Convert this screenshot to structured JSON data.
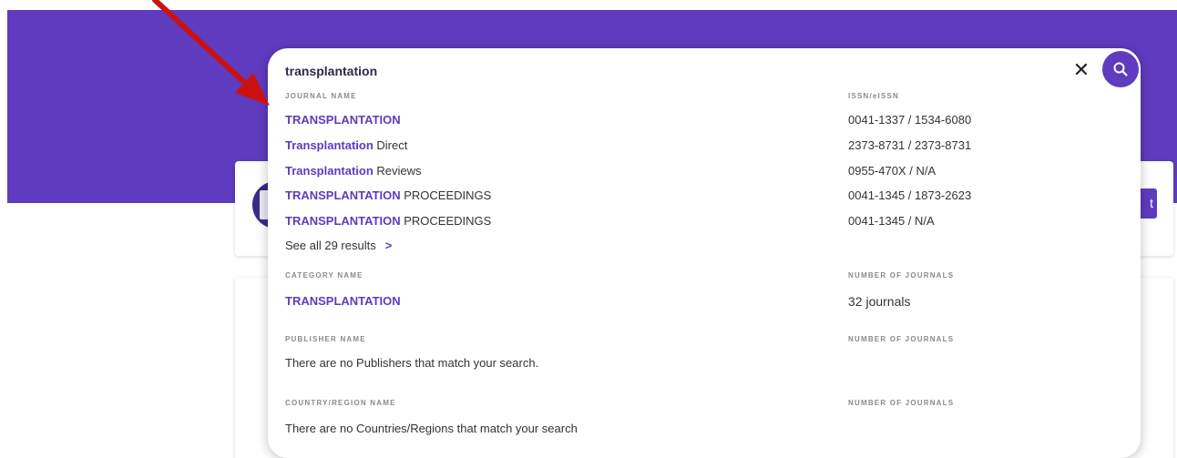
{
  "search": {
    "query": "transplantation"
  },
  "journals": {
    "header_name": "JOURNAL NAME",
    "header_issn": "ISSN/eISSN",
    "rows": [
      {
        "highlight": "TRANSPLANTATION",
        "rest": "",
        "issn": "0041-1337 / 1534-6080"
      },
      {
        "highlight": "Transplantation",
        "rest": " Direct",
        "issn": "2373-8731 / 2373-8731"
      },
      {
        "highlight": "Transplantation",
        "rest": " Reviews",
        "issn": "0955-470X / N/A"
      },
      {
        "highlight": "TRANSPLANTATION",
        "rest": " PROCEEDINGS",
        "issn": "0041-1345 / 1873-2623"
      },
      {
        "highlight": "TRANSPLANTATION",
        "rest": " PROCEEDINGS",
        "issn": "0041-1345 / N/A"
      }
    ],
    "see_all": "See all 29 results"
  },
  "categories": {
    "header_name": "CATEGORY NAME",
    "header_count": "NUMBER OF JOURNALS",
    "name": "TRANSPLANTATION",
    "count": "32 journals"
  },
  "publishers": {
    "header_name": "PUBLISHER NAME",
    "header_count": "NUMBER OF JOURNALS",
    "message": "There are no Publishers that match your search."
  },
  "countries": {
    "header_name": "COUNTRY/REGION NAME",
    "header_count": "NUMBER OF JOURNALS",
    "message": "There are no Countries/Regions that match your search"
  },
  "background": {
    "button_text": "t"
  },
  "colors": {
    "accent": "#5f3bbf",
    "arrow": "#cc1111"
  },
  "icons": [
    "close-icon",
    "search-icon",
    "chevron-right-icon",
    "annotation-arrow"
  ]
}
